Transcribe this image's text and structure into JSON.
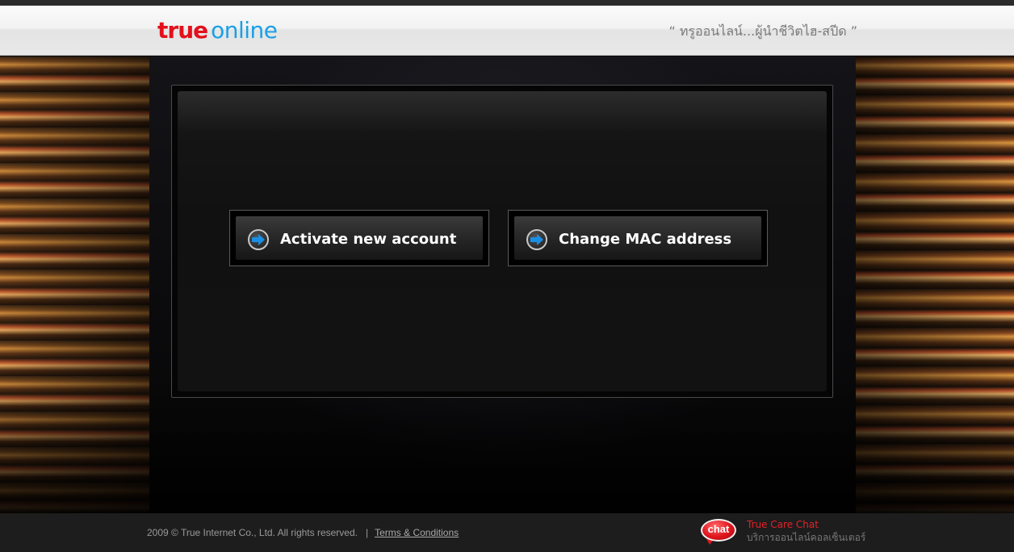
{
  "header": {
    "logo_true": "true",
    "logo_online": "online",
    "tagline": "“ ทรูออนไลน์...ผู้นำชีวิตไฮ-สปีด ”"
  },
  "actions": [
    {
      "label": "Activate new account",
      "icon": "arrow-right-icon"
    },
    {
      "label": "Change MAC address",
      "icon": "arrow-right-icon"
    }
  ],
  "footer": {
    "copyright": "2009 © True Internet Co., Ltd. All rights reserved.",
    "separator": "|",
    "terms_label": "Terms & Conditions",
    "chat_icon_text": "chat",
    "chat_title": "True Care Chat",
    "chat_subtitle": "บริการออนไลน์คอลเซ็นเตอร์"
  },
  "colors": {
    "brand_red": "#e3101b",
    "brand_blue": "#1aa0e6",
    "arrow_blue": "#1a8fe6"
  }
}
